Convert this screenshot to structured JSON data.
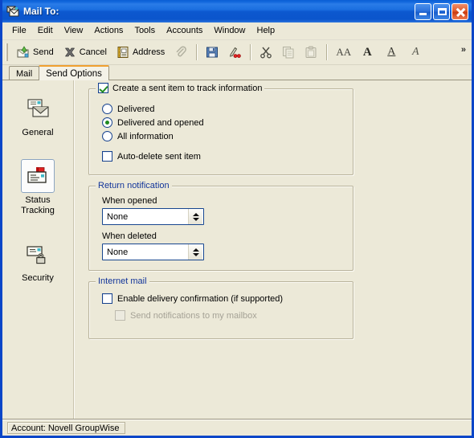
{
  "window": {
    "title": "Mail To:",
    "title_icon": "mail-compose-icon",
    "controls": {
      "minimize": "Minimize",
      "maximize": "Maximize",
      "close": "Close"
    }
  },
  "menubar": {
    "items": [
      {
        "label": "File"
      },
      {
        "label": "Edit"
      },
      {
        "label": "View"
      },
      {
        "label": "Actions"
      },
      {
        "label": "Tools"
      },
      {
        "label": "Accounts"
      },
      {
        "label": "Window"
      },
      {
        "label": "Help"
      }
    ]
  },
  "toolbar": {
    "send_label": "Send",
    "cancel_label": "Cancel",
    "address_label": "Address",
    "attach_label": "",
    "overflow_label": "»",
    "icons": {
      "send": "send-envelope-icon",
      "cancel": "cancel-x-icon",
      "address": "address-book-icon",
      "attach": "paperclip-icon",
      "save": "save-floppy-icon",
      "spellcheck": "spell-check-icon",
      "cut": "scissors-icon",
      "copy": "copy-icon",
      "paste": "paste-icon",
      "font": "font-icon",
      "bold": "bold-icon",
      "underline": "underline-icon",
      "italic": "italic-icon"
    },
    "glyphs": {
      "font": "AA",
      "bold": "A",
      "underline": "A",
      "italic": "A"
    }
  },
  "tabs": [
    {
      "label": "Mail",
      "active": false
    },
    {
      "label": "Send Options",
      "active": true
    }
  ],
  "sidebar": {
    "items": [
      {
        "label": "General",
        "icon": "envelope-icon",
        "selected": false
      },
      {
        "label": "Status\nTracking",
        "label_line1": "Status",
        "label_line2": "Tracking",
        "icon": "envelope-flag-icon",
        "selected": true
      },
      {
        "label": "Security",
        "icon": "envelope-lock-icon",
        "selected": false
      }
    ]
  },
  "panel": {
    "track_group": {
      "checkbox_label": "Create a sent item to track information",
      "checkbox_checked": true,
      "radios": [
        {
          "label": "Delivered",
          "selected": false
        },
        {
          "label": "Delivered and opened",
          "selected": true
        },
        {
          "label": "All information",
          "selected": false
        }
      ],
      "auto_delete_label": "Auto-delete sent item",
      "auto_delete_checked": false
    },
    "return_notification": {
      "legend": "Return notification",
      "when_opened_label": "When opened",
      "when_opened_value": "None",
      "when_deleted_label": "When deleted",
      "when_deleted_value": "None",
      "options": [
        "None"
      ]
    },
    "internet_mail": {
      "legend": "Internet mail",
      "enable_label": "Enable delivery confirmation (if supported)",
      "enable_checked": false,
      "notify_label": "Send notifications to my mailbox",
      "notify_checked": false,
      "notify_disabled": true
    }
  },
  "statusbar": {
    "text": "Account: Novell GroupWise"
  },
  "colors": {
    "face": "#ece9d8",
    "title_blue": "#0a5fd4",
    "legend_blue": "#12359a",
    "accent_orange": "#f0a030",
    "check_green": "#1f8a1f",
    "border_navy": "#16418c"
  }
}
